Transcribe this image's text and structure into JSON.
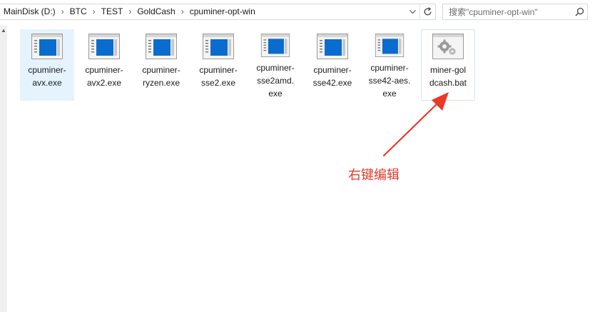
{
  "address_bar": {
    "breadcrumbs": [
      "MainDisk (D:)",
      "BTC",
      "TEST",
      "GoldCash",
      "cpuminer-opt-win"
    ],
    "separator": "›"
  },
  "search": {
    "placeholder": "搜索\"cpuminer-opt-win\""
  },
  "files": [
    {
      "label": "cpuminer-avx.exe",
      "icon": "exe-icon",
      "state": "selected"
    },
    {
      "label": "cpuminer-avx2.exe",
      "icon": "exe-icon",
      "state": "normal"
    },
    {
      "label": "cpuminer-ryzen.exe",
      "icon": "exe-icon",
      "state": "normal"
    },
    {
      "label": "cpuminer-sse2.exe",
      "icon": "exe-icon",
      "state": "normal"
    },
    {
      "label": "cpuminer-sse2amd.exe",
      "icon": "exe-icon",
      "state": "normal"
    },
    {
      "label": "cpuminer-sse42.exe",
      "icon": "exe-icon",
      "state": "normal"
    },
    {
      "label": "cpuminer-sse42-aes.exe",
      "icon": "exe-icon",
      "state": "normal"
    },
    {
      "label": "miner-goldcash.bat",
      "icon": "bat-gear-icon",
      "state": "hover"
    }
  ],
  "file_labels": [
    [
      "cpuminer-",
      "avx.exe"
    ],
    [
      "cpuminer-",
      "avx2.exe"
    ],
    [
      "cpuminer-",
      "ryzen.exe"
    ],
    [
      "cpuminer-",
      "sse2.exe"
    ],
    [
      "cpuminer-",
      "sse2amd.",
      "exe"
    ],
    [
      "cpuminer-",
      "sse42.exe"
    ],
    [
      "cpuminer-",
      "sse42-aes.",
      "exe"
    ],
    [
      "miner-gol",
      "dcash.bat"
    ]
  ],
  "annotation": {
    "text": "右键编辑",
    "color": "#e8392b"
  },
  "colors": {
    "selected_bg": "#e5f3ff",
    "hover_border": "#cce8ff",
    "exe_blue": "#0a6cce"
  }
}
